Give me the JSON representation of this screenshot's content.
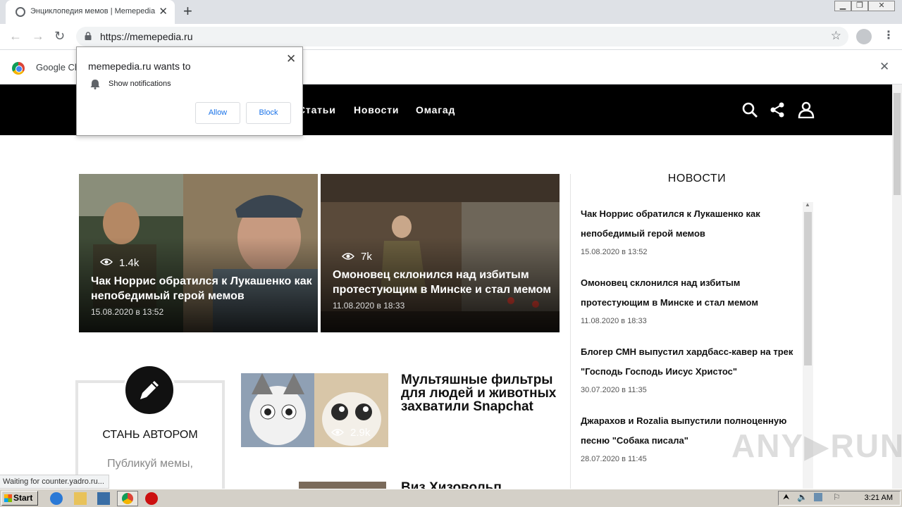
{
  "browser": {
    "tab_title": "Энциклопедия мемов | Memepedia",
    "url": "https://memepedia.ru",
    "infobar_text": "Google Ch"
  },
  "permission_popup": {
    "title": "memepedia.ru wants to",
    "permission": "Show notifications",
    "allow_label": "Allow",
    "block_label": "Block"
  },
  "site": {
    "nav": [
      "Статьи",
      "Новости",
      "Омагад"
    ],
    "featured": [
      {
        "views": "1.4k",
        "title": "Чак Норрис обратился к Лукашенко как непобедимый герой мемов",
        "date": "15.08.2020 в 13:52"
      },
      {
        "views": "7k",
        "title": "Омоновец склонился над избитым протестующим в Минске и стал мемом",
        "date": "11.08.2020 в 18:33"
      }
    ],
    "author_box": {
      "title": "СТАНЬ АВТОРОМ",
      "subtitle": "Публикуй мемы,"
    },
    "articles": [
      {
        "title": "Мультяшные фильтры для людей и животных захватили Snapchat",
        "views": "2.9k"
      },
      {
        "title": "Виз Хизовольп"
      }
    ],
    "news_heading": "НОВОСТИ",
    "news": [
      {
        "title": "Чак Норрис обратился к Лукашенко как непобедимый герой мемов",
        "date": "15.08.2020 в 13:52"
      },
      {
        "title": "Омоновец склонился над избитым протестующим в Минске и стал мемом",
        "date": "11.08.2020 в 18:33"
      },
      {
        "title": "Блогер СМН выпустил хардбасс-кавер на трек \"Господь Господь Иисус Христос\"",
        "date": "30.07.2020 в 11:35"
      },
      {
        "title": "Джарахов и Rozalia выпустили полноценную песню \"Собака писала\"",
        "date": "28.07.2020 в 11:45"
      }
    ]
  },
  "status_text": "Waiting for counter.yadro.ru...",
  "watermark": "ANY▶RUN",
  "taskbar": {
    "start_label": "Start",
    "clock": "3:21 AM"
  },
  "icons": [
    "globe-icon",
    "close-icon",
    "plus-icon",
    "back-icon",
    "forward-icon",
    "reload-icon",
    "lock-icon",
    "star-icon",
    "profile-icon",
    "menu-icon",
    "search-icon",
    "share-icon",
    "user-icon",
    "pencil-icon",
    "eye-icon",
    "bell-icon"
  ]
}
